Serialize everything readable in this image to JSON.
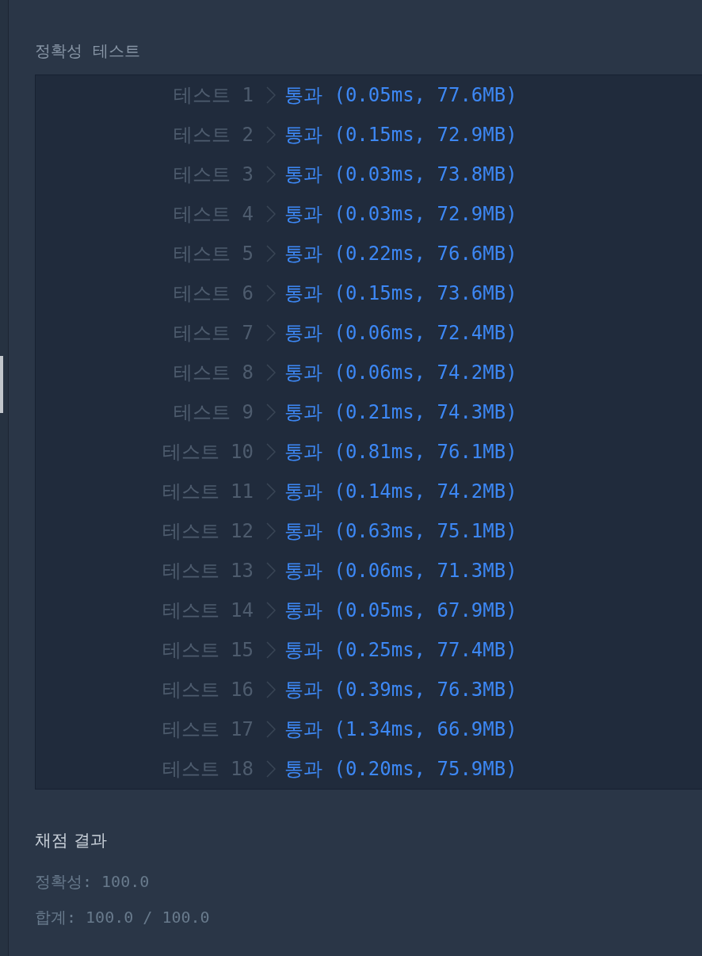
{
  "section_title": "정확성  테스트",
  "tests": [
    {
      "label": "테스트 1",
      "result": "통과 (0.05ms, 77.6MB)"
    },
    {
      "label": "테스트 2",
      "result": "통과 (0.15ms, 72.9MB)"
    },
    {
      "label": "테스트 3",
      "result": "통과 (0.03ms, 73.8MB)"
    },
    {
      "label": "테스트 4",
      "result": "통과 (0.03ms, 72.9MB)"
    },
    {
      "label": "테스트 5",
      "result": "통과 (0.22ms, 76.6MB)"
    },
    {
      "label": "테스트 6",
      "result": "통과 (0.15ms, 73.6MB)"
    },
    {
      "label": "테스트 7",
      "result": "통과 (0.06ms, 72.4MB)"
    },
    {
      "label": "테스트 8",
      "result": "통과 (0.06ms, 74.2MB)"
    },
    {
      "label": "테스트 9",
      "result": "통과 (0.21ms, 74.3MB)"
    },
    {
      "label": "테스트 10",
      "result": "통과 (0.81ms, 76.1MB)"
    },
    {
      "label": "테스트 11",
      "result": "통과 (0.14ms, 74.2MB)"
    },
    {
      "label": "테스트 12",
      "result": "통과 (0.63ms, 75.1MB)"
    },
    {
      "label": "테스트 13",
      "result": "통과 (0.06ms, 71.3MB)"
    },
    {
      "label": "테스트 14",
      "result": "통과 (0.05ms, 67.9MB)"
    },
    {
      "label": "테스트 15",
      "result": "통과 (0.25ms, 77.4MB)"
    },
    {
      "label": "테스트 16",
      "result": "통과 (0.39ms, 76.3MB)"
    },
    {
      "label": "테스트 17",
      "result": "통과 (1.34ms, 66.9MB)"
    },
    {
      "label": "테스트 18",
      "result": "통과 (0.20ms, 75.9MB)"
    }
  ],
  "grading": {
    "title": "채점 결과",
    "lines": [
      "정확성: 100.0",
      "합계: 100.0 / 100.0"
    ]
  }
}
